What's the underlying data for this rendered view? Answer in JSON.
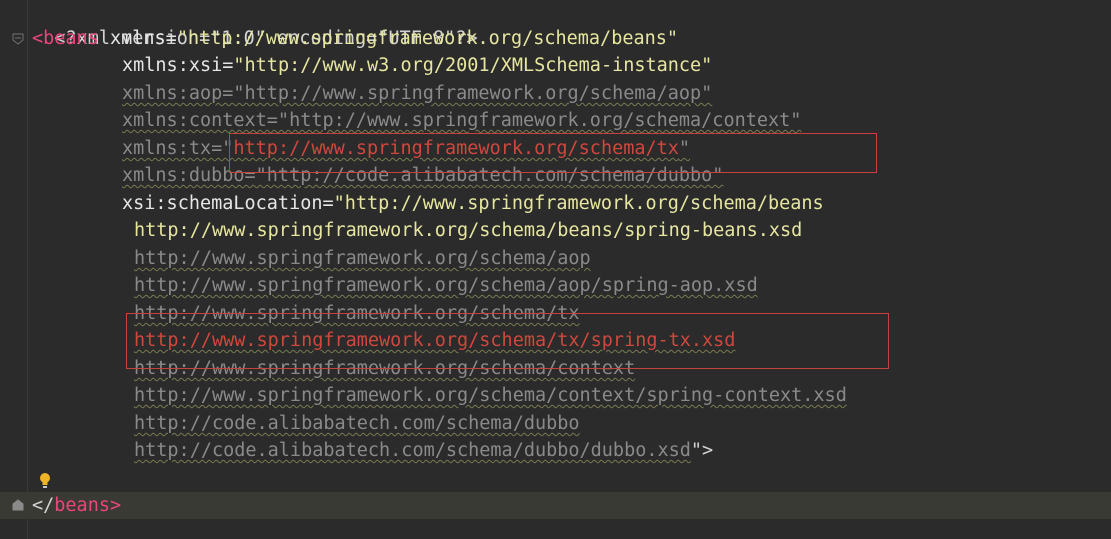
{
  "editor": {
    "line1": "<?xml version=\"1.0\" encoding=\"UTF-8\"?>",
    "beans_open": "<",
    "beans_tag": "beans",
    "beans_ns_attr": " xmlns=",
    "beans_ns_val": "\"http://www.springframework.org/schema/beans\"",
    "xsi_attr": "xmlns:xsi=",
    "xsi_val": "\"http://www.w3.org/2001/XMLSchema-instance\"",
    "aop_line": "xmlns:aop=\"http://www.springframework.org/schema/aop\"",
    "context_line": "xmlns:context=\"http://www.springframework.org/schema/context\"",
    "tx_attr": "xmlns:tx=\"",
    "tx_url": "http://www.springframework.org/schema/tx",
    "tx_close": "\"",
    "dubbo_line": "xmlns:dubbo=\"http://code.alibabatech.com/schema/dubbo\"",
    "schema_attr": "xsi:schemaLocation=",
    "schema_val": "\"http://www.springframework.org/schema/beans",
    "loc1": "http://www.springframework.org/schema/beans/spring-beans.xsd",
    "loc2": "http://www.springframework.org/schema/aop",
    "loc3": "http://www.springframework.org/schema/aop/spring-aop.xsd",
    "loc4": "http://www.springframework.org/schema/tx",
    "loc5": "http://www.springframework.org/schema/tx/spring-tx.xsd",
    "loc6": "http://www.springframework.org/schema/context",
    "loc7": "http://www.springframework.org/schema/context/spring-context.xsd",
    "loc8": "http://code.alibabatech.com/schema/dubbo",
    "loc9": "http://code.alibabatech.com/schema/dubbo/dubbo.xsd",
    "loc9_close": "\">",
    "close_open": "</",
    "close_tag": "beans",
    "close_end": ">"
  },
  "colors": {
    "highlight_box": "#c94040",
    "background": "#2b2b2b"
  },
  "icons": {
    "bulb": "lightbulb-icon",
    "fold": "fold-icon"
  }
}
